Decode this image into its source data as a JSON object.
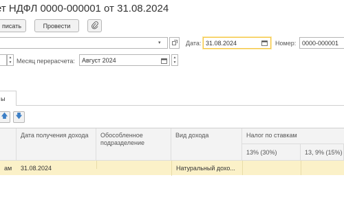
{
  "title": "ет НДФЛ 0000-000001 от 31.08.2024",
  "toolbar": {
    "post_label": "писать",
    "conduct_label": "Провести"
  },
  "form": {
    "date_label": "Дата:",
    "date_value": "31.08.2024",
    "number_label": "Номер:",
    "number_value": "0000-000001",
    "recalc_month_label": "Месяц перерасчета:",
    "recalc_month_value": "Август 2024"
  },
  "tab_label": "ы",
  "table": {
    "headers": {
      "income_date": "Дата получения дохода",
      "subdivision": "Обособленное подразделение",
      "income_type": "Вид дохода",
      "tax_by_rates": "Налог по ставкам",
      "rate_13": "13% (30%)",
      "rate_13_9": "13, 9% (15%)"
    },
    "rows": [
      {
        "col0": "ам",
        "income_date": "31.08.2024",
        "subdivision": "",
        "income_type": "Натуральный дохо...",
        "rate_13": "",
        "rate_13_9": ""
      }
    ]
  },
  "colors": {
    "selected_row": "#fbf1c8",
    "focus_border": "#f5c542",
    "arrow_blue": "#3c7fc6"
  }
}
